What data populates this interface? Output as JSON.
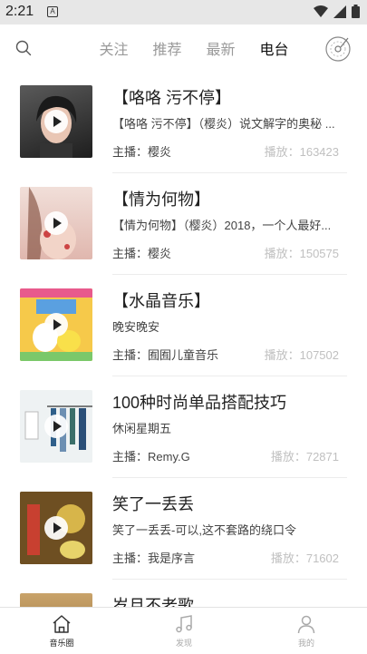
{
  "status_bar": {
    "time": "2:21",
    "sim_label": "A"
  },
  "top_tabs": [
    {
      "label": "关注",
      "active": false
    },
    {
      "label": "推荐",
      "active": false
    },
    {
      "label": "最新",
      "active": false
    },
    {
      "label": "电台",
      "active": true
    }
  ],
  "items": [
    {
      "title": "【咯咯 污不停】",
      "description": "【咯咯 污不停】（樱炎）说文解字的奥秘 ...",
      "host": "主播：樱炎",
      "plays": "播放：163423",
      "thumb_color": "#3a3a3a"
    },
    {
      "title": "【情为何物】",
      "description": "【情为何物】（樱炎）2018，一个人最好...",
      "host": "主播：樱炎",
      "plays": "播放：150575",
      "thumb_color": "#e8c9c3"
    },
    {
      "title": "【水晶音乐】",
      "description": "晚安晚安",
      "host": "主播：囿囿儿童音乐",
      "plays": "播放：107502",
      "thumb_color": "#f4d24a"
    },
    {
      "title": "100种时尚单品搭配技巧",
      "description": "休闲星期五",
      "host": "主播：Remy.G",
      "plays": "播放：72871",
      "thumb_color": "#d9e2e6"
    },
    {
      "title": "笑了一丢丢",
      "description": "笑了一丢丢-可以,这不套路的绕口令",
      "host": "主播：我是序言",
      "plays": "播放：71602",
      "thumb_color": "#8a6b2c"
    },
    {
      "title": "岁月不老歌",
      "description": "",
      "host": "",
      "plays": "",
      "thumb_color": "#b8925a"
    }
  ],
  "bottom_nav": [
    {
      "label": "音乐圈",
      "active": true
    },
    {
      "label": "发现",
      "active": false
    },
    {
      "label": "我的",
      "active": false
    }
  ]
}
